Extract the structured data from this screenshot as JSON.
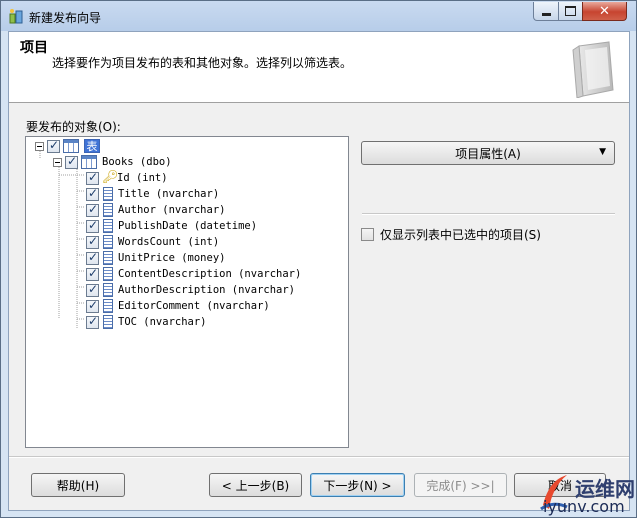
{
  "window": {
    "title": "新建发布向导"
  },
  "header": {
    "title": "项目",
    "description": "选择要作为项目发布的表和其他对象。选择列以筛选表。"
  },
  "objects": {
    "label": "要发布的对象(O):",
    "tables_root_icon_text": "表",
    "table": {
      "label": "Books (dbo)",
      "checked": true
    },
    "columns": [
      {
        "label": "Id (int)",
        "checked": true,
        "icon": "key-icon"
      },
      {
        "label": "Title (nvarchar)",
        "checked": true,
        "icon": "column-icon"
      },
      {
        "label": "Author (nvarchar)",
        "checked": true,
        "icon": "column-icon"
      },
      {
        "label": "PublishDate (datetime)",
        "checked": true,
        "icon": "column-icon"
      },
      {
        "label": "WordsCount (int)",
        "checked": true,
        "icon": "column-icon"
      },
      {
        "label": "UnitPrice (money)",
        "checked": true,
        "icon": "column-icon"
      },
      {
        "label": "ContentDescription (nvarchar)",
        "checked": true,
        "icon": "column-icon"
      },
      {
        "label": "AuthorDescription (nvarchar)",
        "checked": true,
        "icon": "column-icon"
      },
      {
        "label": "EditorComment (nvarchar)",
        "checked": true,
        "icon": "column-icon"
      },
      {
        "label": "TOC (nvarchar)",
        "checked": true,
        "icon": "column-icon"
      }
    ]
  },
  "right": {
    "properties_button": "项目属性(A)",
    "only_selected_label": "仅显示列表中已选中的项目(S)",
    "only_selected_checked": false
  },
  "footer": {
    "help": "帮助(H)",
    "prev": "< 上一步(B)",
    "next": "下一步(N) >",
    "finish": "完成(F) >>|",
    "cancel": "取消"
  },
  "watermark": {
    "line1": "运维网",
    "line2": "iyunv.com"
  },
  "colors": {
    "titlebar": "#c9daf0",
    "close_button": "#c74430",
    "dialog_bg": "#f0f0f0",
    "tables_icon": "#3f73d6"
  }
}
